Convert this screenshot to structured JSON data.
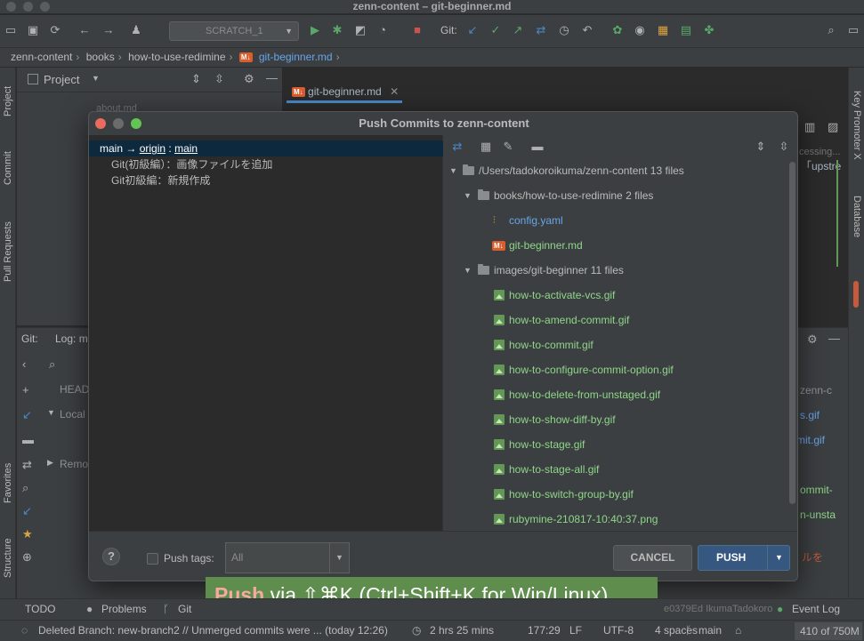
{
  "window": {
    "title": "zenn-content – git-beginner.md"
  },
  "toolbar": {
    "run_config": "SCRATCH_1",
    "git_label": "Git:"
  },
  "breadcrumb": {
    "items": [
      "zenn-content",
      "books",
      "how-to-use-redimine",
      "git-beginner.md"
    ]
  },
  "side_tabs": {
    "left": [
      "Project",
      "Commit",
      "Pull Requests",
      "Favorites",
      "Structure"
    ],
    "right": [
      "Key Promoter X",
      "Database"
    ]
  },
  "project_panel": {
    "title": "Project",
    "file_faint": "about.md"
  },
  "editor": {
    "tab_label": "git-beginner.md",
    "partial_text_1": "cessing...",
    "partial_text_2": "「upstre",
    "partial_text_3": "zenn-c",
    "partial_text_4": "s.gif",
    "partial_text_5": "mit.gif",
    "partial_text_6": "ommit-",
    "partial_text_7": "n-unsta",
    "partial_text_8": "ルを"
  },
  "git_panel": {
    "tab_git": "Git:",
    "tab_log": "Log: m",
    "head_label": "HEAD",
    "local_label": "Local",
    "remote_label": "Remo"
  },
  "dialog": {
    "title": "Push Commits to zenn-content",
    "commit_branch": {
      "local": "main",
      "remote": "origin",
      "target": "main"
    },
    "commits": [
      "Git(初級編）：画像ファイルを追加",
      "Git初級編：新規作成"
    ],
    "tree": {
      "root": {
        "path": "/Users/tadokoroikuma/zenn-content",
        "count": "13 files"
      },
      "folder1": {
        "path": "books/how-to-use-redimine",
        "count": "2 files"
      },
      "folder1_files": [
        "config.yaml",
        "git-beginner.md"
      ],
      "folder2": {
        "path": "images/git-beginner",
        "count": "11 files"
      },
      "folder2_files": [
        "how-to-activate-vcs.gif",
        "how-to-amend-commit.gif",
        "how-to-commit.gif",
        "how-to-configure-commit-option.gif",
        "how-to-delete-from-unstaged.gif",
        "how-to-show-diff-by.gif",
        "how-to-stage.gif",
        "how-to-stage-all.gif",
        "how-to-switch-group-by.gif",
        "rubymine-210817-10:40:37.png"
      ]
    },
    "footer": {
      "help": "?",
      "push_tags_label": "Push tags:",
      "tags_select_value": "All",
      "cancel": "CANCEL",
      "push": "PUSH"
    }
  },
  "banner": {
    "action": "Push",
    "rest": " via ⇧⌘K (Ctrl+Shift+K for Win/Linux)"
  },
  "bottom_tools": {
    "todo": "TODO",
    "problems": "Problems",
    "git": "Git",
    "event_log": "Event Log",
    "faint": "e0379Ed IkumaTadokoro"
  },
  "status": {
    "message": "Deleted Branch: new-branch2 // Unmerged commits were ... (today 12:26)",
    "time": "2 hrs 25 mins",
    "position": "177:29",
    "line_sep": "LF",
    "encoding": "UTF-8",
    "indent": "4 spaces",
    "branch": "main",
    "memory": "410 of 750M"
  },
  "colors": {
    "accent": "#365880",
    "selection": "#0d293e",
    "added_file": "#8fd68a",
    "modified_file": "#68a5e8",
    "banner_bg": "#5f8d4e"
  }
}
